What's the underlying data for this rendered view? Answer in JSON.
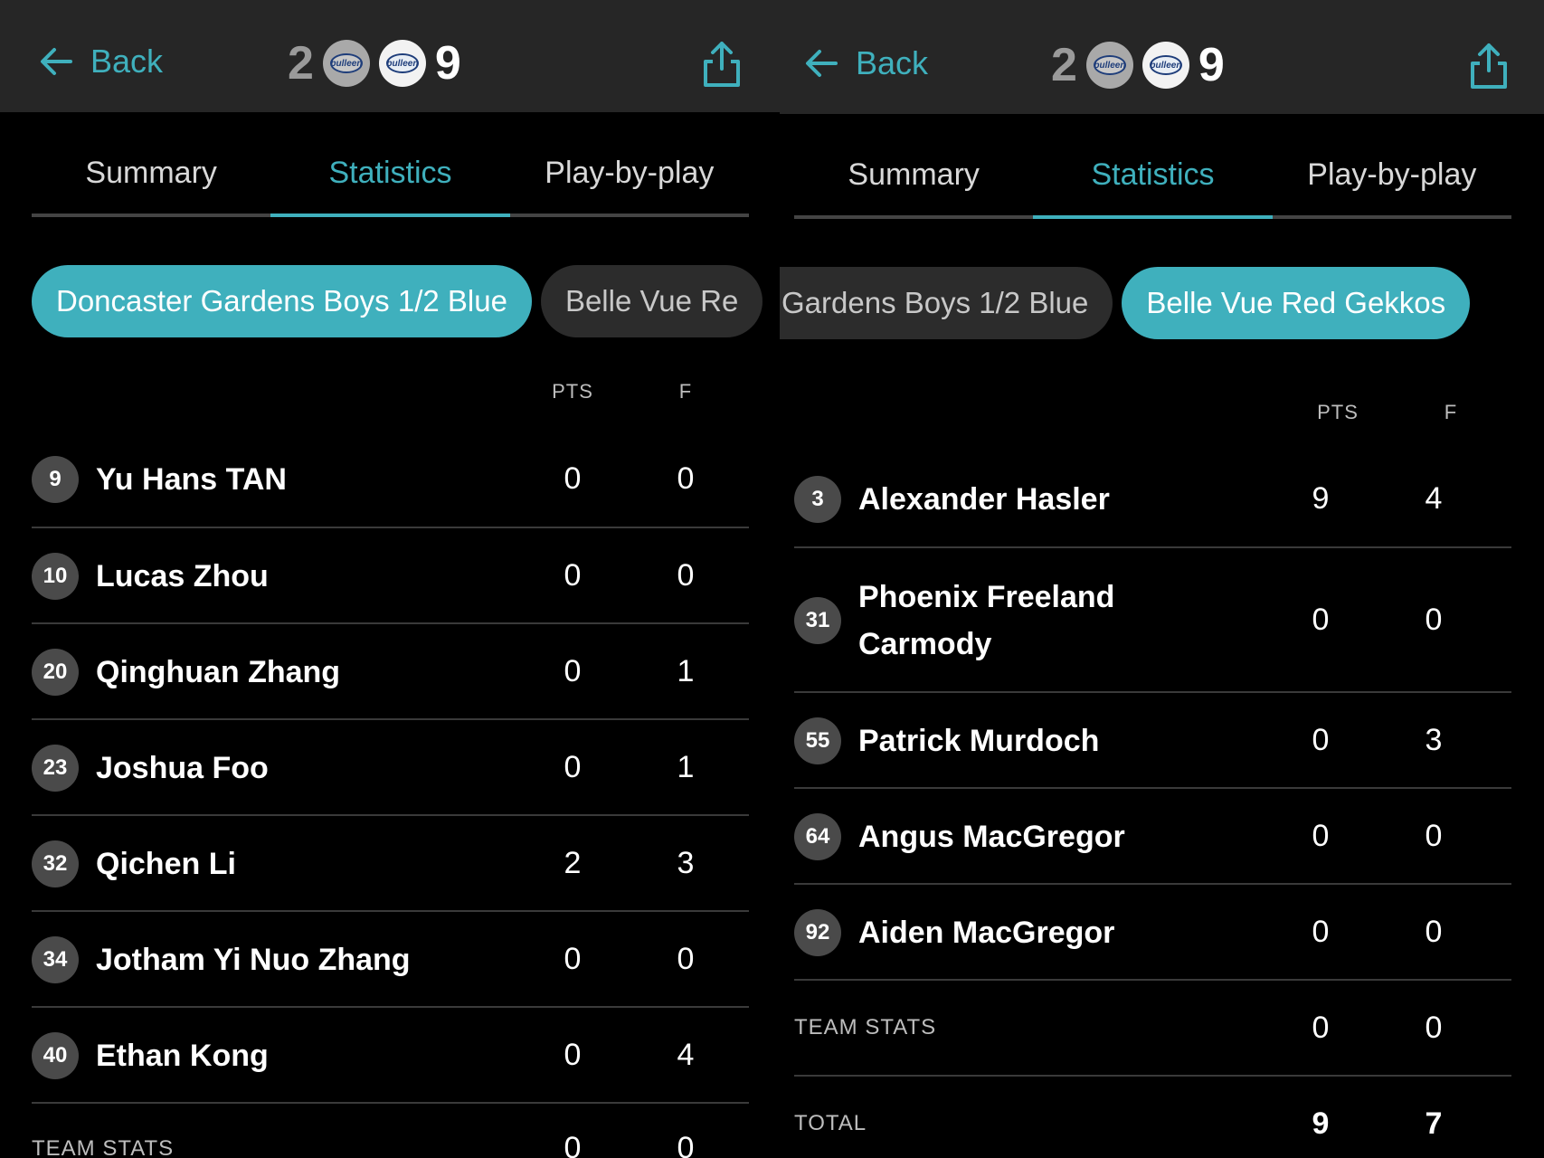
{
  "header": {
    "back_label": "Back",
    "home_score": "2",
    "away_score": "9",
    "home_logo_text": "bulleen",
    "away_logo_text": "bulleen"
  },
  "tabs": [
    {
      "label": "Summary",
      "active": false
    },
    {
      "label": "Statistics",
      "active": true
    },
    {
      "label": "Play-by-play",
      "active": false
    }
  ],
  "columns": {
    "pts": "PTS",
    "f": "F"
  },
  "left_panel": {
    "chips": [
      {
        "label": "Doncaster Gardens Boys 1/2 Blue",
        "active": true
      },
      {
        "label": "Belle Vue Re",
        "active": false
      }
    ],
    "players": [
      {
        "number": "9",
        "name": "Yu Hans TAN",
        "pts": "0",
        "f": "0"
      },
      {
        "number": "10",
        "name": "Lucas Zhou",
        "pts": "0",
        "f": "0"
      },
      {
        "number": "20",
        "name": "Qinghuan Zhang",
        "pts": "0",
        "f": "1"
      },
      {
        "number": "23",
        "name": "Joshua Foo",
        "pts": "0",
        "f": "1"
      },
      {
        "number": "32",
        "name": "Qichen Li",
        "pts": "2",
        "f": "3"
      },
      {
        "number": "34",
        "name": "Jotham Yi Nuo Zhang",
        "pts": "0",
        "f": "0"
      },
      {
        "number": "40",
        "name": "Ethan Kong",
        "pts": "0",
        "f": "4"
      }
    ],
    "team_stats": {
      "label": "TEAM STATS",
      "pts": "0",
      "f": "0"
    }
  },
  "right_panel": {
    "chips": [
      {
        "label": "Gardens Boys 1/2 Blue",
        "active": false
      },
      {
        "label": "Belle Vue Red Gekkos",
        "active": true
      }
    ],
    "players": [
      {
        "number": "3",
        "name": "Alexander Hasler",
        "pts": "9",
        "f": "4"
      },
      {
        "number": "31",
        "name": "Phoenix Freeland Carmody",
        "pts": "0",
        "f": "0"
      },
      {
        "number": "55",
        "name": "Patrick Murdoch",
        "pts": "0",
        "f": "3"
      },
      {
        "number": "64",
        "name": "Angus MacGregor",
        "pts": "0",
        "f": "0"
      },
      {
        "number": "92",
        "name": "Aiden MacGregor",
        "pts": "0",
        "f": "0"
      }
    ],
    "team_stats": {
      "label": "TEAM STATS",
      "pts": "0",
      "f": "0"
    },
    "total": {
      "label": "TOTAL",
      "pts": "9",
      "f": "7"
    }
  },
  "colors": {
    "accent": "#3fb0bd",
    "header_bg": "#262626",
    "badge_bg": "#4a4a4a",
    "chip_inactive_bg": "#2c2c2c"
  },
  "icons": {
    "back": "arrow-left-icon",
    "share": "share-icon"
  }
}
